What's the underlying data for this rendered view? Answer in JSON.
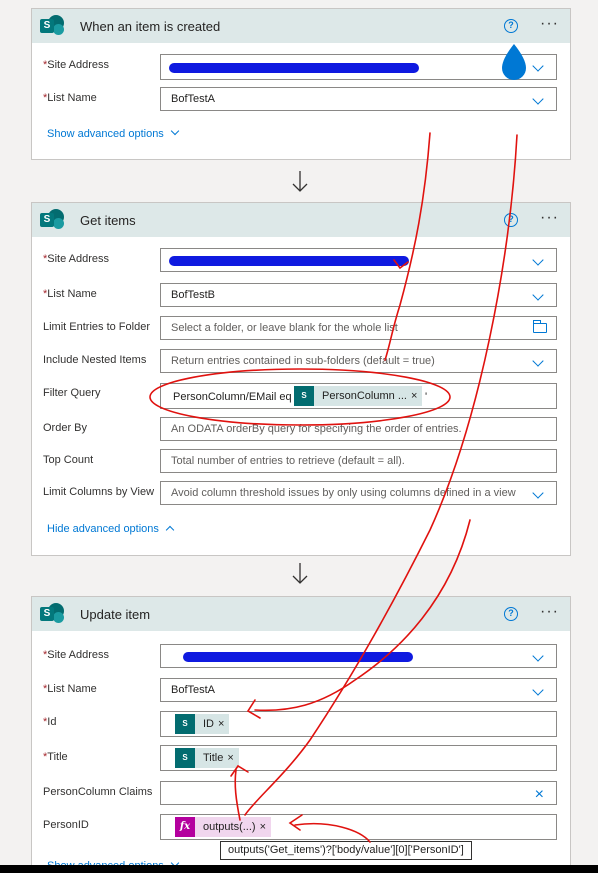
{
  "card1": {
    "title": "When an item is created",
    "fields": {
      "site_address_label": "Site Address",
      "list_name_label": "List Name",
      "list_name_value": "BofTestA"
    },
    "advanced": "Show advanced options"
  },
  "card2": {
    "title": "Get items",
    "site_address_label": "Site Address",
    "list_name_label": "List Name",
    "list_name_value": "BofTestB",
    "limit_label": "Limit Entries to Folder",
    "limit_placeholder": "Select a folder, or leave blank for the whole list",
    "nested_label": "Include Nested Items",
    "nested_placeholder": "Return entries contained in sub-folders (default = true)",
    "filter_label": "Filter Query",
    "filter_text": "PersonColumn/EMail eq '",
    "filter_token": "PersonColumn ...",
    "filter_suffix": "'",
    "order_label": "Order By",
    "order_placeholder": "An ODATA orderBy query for specifying the order of entries.",
    "top_label": "Top Count",
    "top_placeholder": "Total number of entries to retrieve (default = all).",
    "limitcols_label": "Limit Columns by View",
    "limitcols_placeholder": "Avoid column threshold issues by only using columns defined in a view",
    "advanced": "Hide advanced options"
  },
  "card3": {
    "title": "Update item",
    "site_address_label": "Site Address",
    "list_name_label": "List Name",
    "list_name_value": "BofTestA",
    "id_label": "Id",
    "id_token": "ID",
    "title_label": "Title",
    "title_token": "Title",
    "claims_label": "PersonColumn Claims",
    "personid_label": "PersonID",
    "personid_token": "outputs(...)",
    "advanced": "Show advanced options"
  },
  "tooltip": "outputs('Get_items')?['body/value'][0]['PersonID']",
  "icons": {
    "help": "?",
    "more": "···",
    "close": "×",
    "fx": "fx",
    "sp": "S"
  },
  "colors": {
    "header_bg": "#dde8e8",
    "accent": "#0078d4",
    "sharepoint": "#036c70",
    "annotation_red": "#e0120f",
    "redaction_blue": "#0f1ae0"
  }
}
